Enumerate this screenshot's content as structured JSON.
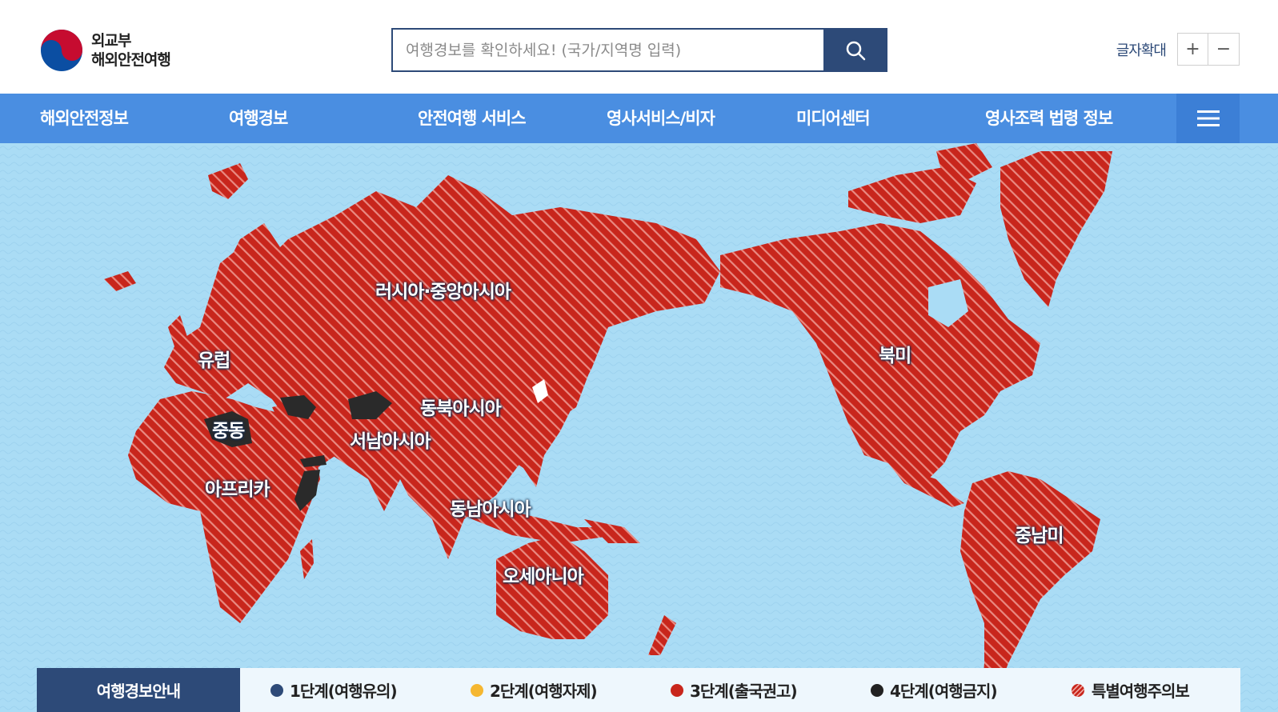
{
  "logo": {
    "line1": "외교부",
    "line2": "해외안전여행"
  },
  "search": {
    "placeholder": "여행경보를 확인하세요! (국가/지역명 입력)"
  },
  "font_controls": {
    "label": "글자확대",
    "plus": "+",
    "minus": "−"
  },
  "nav": {
    "items": [
      "해외안전정보",
      "여행경보",
      "안전여행 서비스",
      "영사서비스/비자",
      "미디어센터",
      "영사조력 법령 정보"
    ]
  },
  "map": {
    "regions": [
      "러시아·중앙아시아",
      "유럽",
      "중동",
      "아프리카",
      "서남아시아",
      "동북아시아",
      "동남아시아",
      "오세아니아",
      "북미",
      "중남미"
    ]
  },
  "legend": {
    "title": "여행경보안내",
    "items": [
      {
        "label": "1단계(여행유의)",
        "color": "#2d4a78"
      },
      {
        "label": "2단계(여행자제)",
        "color": "#f5b731"
      },
      {
        "label": "3단계(출국권고)",
        "color": "#c8261c"
      },
      {
        "label": "4단계(여행금지)",
        "color": "#222222"
      },
      {
        "label": "특별여행주의보",
        "color": "#c8261c"
      }
    ]
  },
  "colors": {
    "nav": "#4a8ee1",
    "brand": "#2d4a78",
    "ocean": "#aadcf5",
    "land_level3": "#c8261c",
    "level4": "#2a2a2a"
  }
}
